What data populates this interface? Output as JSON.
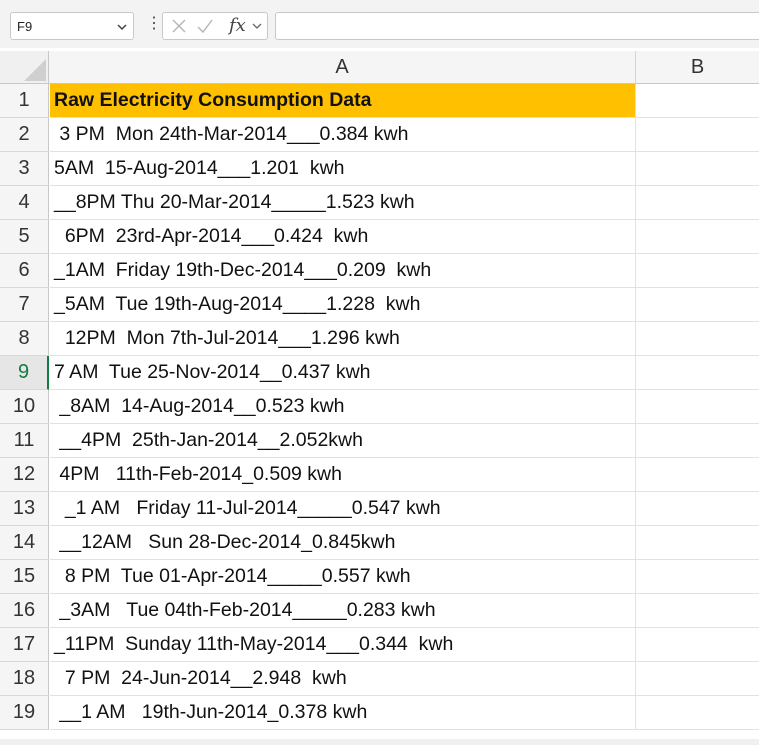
{
  "formula_bar": {
    "cell_reference": "F9",
    "fx_label": "fx",
    "formula_value": ""
  },
  "columns": [
    "A",
    "B"
  ],
  "selected_row": "9",
  "rows": [
    {
      "num": "1",
      "a": "Raw Electricity Consumption Data"
    },
    {
      "num": "2",
      "a": " 3 PM  Mon 24th-Mar-2014___0.384 kwh"
    },
    {
      "num": "3",
      "a": "5AM  15-Aug-2014___1.201  kwh"
    },
    {
      "num": "4",
      "a": "__8PM Thu 20-Mar-2014_____1.523 kwh"
    },
    {
      "num": "5",
      "a": "  6PM  23rd-Apr-2014___0.424  kwh"
    },
    {
      "num": "6",
      "a": "_1AM  Friday 19th-Dec-2014___0.209  kwh"
    },
    {
      "num": "7",
      "a": "_5AM  Tue 19th-Aug-2014____1.228  kwh"
    },
    {
      "num": "8",
      "a": "  12PM  Mon 7th-Jul-2014___1.296 kwh"
    },
    {
      "num": "9",
      "a": "7 AM  Tue 25-Nov-2014__0.437 kwh"
    },
    {
      "num": "10",
      "a": " _8AM  14-Aug-2014__0.523 kwh"
    },
    {
      "num": "11",
      "a": " __4PM  25th-Jan-2014__2.052kwh"
    },
    {
      "num": "12",
      "a": " 4PM   11th-Feb-2014_0.509 kwh"
    },
    {
      "num": "13",
      "a": "  _1 AM   Friday 11-Jul-2014_____0.547 kwh"
    },
    {
      "num": "14",
      "a": " __12AM   Sun 28-Dec-2014_0.845kwh"
    },
    {
      "num": "15",
      "a": "  8 PM  Tue 01-Apr-2014_____0.557 kwh"
    },
    {
      "num": "16",
      "a": " _3AM   Tue 04th-Feb-2014_____0.283 kwh"
    },
    {
      "num": "17",
      "a": "_11PM  Sunday 11th-May-2014___0.344  kwh"
    },
    {
      "num": "18",
      "a": "  7 PM  24-Jun-2014__2.948  kwh"
    },
    {
      "num": "19",
      "a": " __1 AM   19th-Jun-2014_0.378 kwh"
    }
  ],
  "colors": {
    "header_fill": "#ffc000",
    "selection_accent": "#107c41"
  }
}
